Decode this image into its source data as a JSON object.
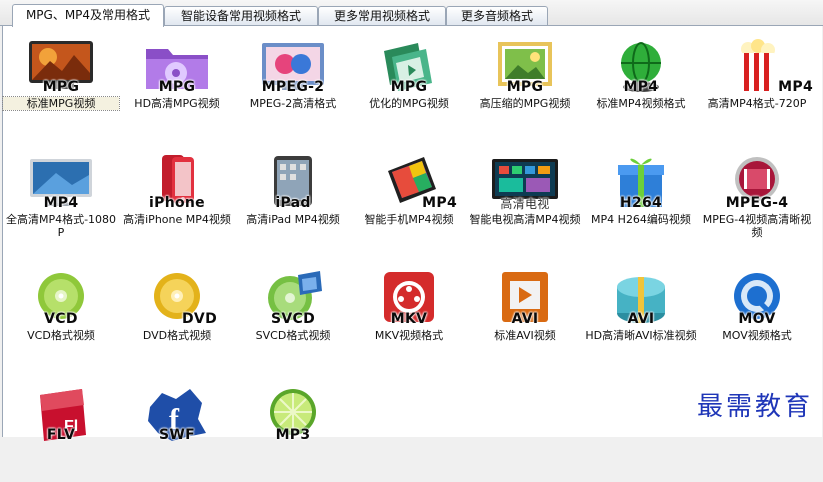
{
  "tabs": [
    {
      "label": "MPG、MP4及常用格式",
      "active": true
    },
    {
      "label": "智能设备常用视频格式",
      "active": false
    },
    {
      "label": "更多常用视频格式",
      "active": false
    },
    {
      "label": "更多音频格式",
      "active": false
    }
  ],
  "formats": [
    {
      "label": "MPG",
      "caption": "标准MPG视频",
      "icon": "film-projector-icon"
    },
    {
      "label": "MPG",
      "caption": "HD高清MPG视频",
      "icon": "media-folder-icon"
    },
    {
      "label": "MPEG-2",
      "caption": "MPEG-2高清格式",
      "icon": "mpeg2-screen-icon"
    },
    {
      "label": "MPG",
      "caption": "优化的MPG视频",
      "icon": "film-reel-icon"
    },
    {
      "label": "MPG",
      "caption": "高压缩的MPG视频",
      "icon": "photo-frame-icon"
    },
    {
      "label": "MP4",
      "caption": "标准MP4视频格式",
      "icon": "green-globe-icon"
    },
    {
      "label": "MP4",
      "caption": "高清MP4格式-720P",
      "icon": "popcorn-icon"
    },
    {
      "label": "MP4",
      "caption": "全高清MP4格式-1080P",
      "icon": "monitor-icon"
    },
    {
      "label": "iPhone",
      "caption": "高清iPhone MP4视频",
      "icon": "iphone-icon"
    },
    {
      "label": "iPad",
      "caption": "高清iPad MP4视频",
      "icon": "ipad-icon"
    },
    {
      "label": "MP4",
      "caption": "智能手机MP4视频",
      "icon": "smartphone-icon"
    },
    {
      "label": "高清电视",
      "caption": "智能电视高清MP4视频",
      "icon": "smart-tv-icon"
    },
    {
      "label": "H264",
      "caption": "MP4 H264编码视频",
      "icon": "gift-box-icon"
    },
    {
      "label": "MPEG-4",
      "caption": "MPEG-4视频高清晰视频",
      "icon": "film-badge-icon"
    },
    {
      "label": "VCD",
      "caption": "VCD格式视频",
      "icon": "vcd-disc-icon"
    },
    {
      "label": "DVD",
      "caption": "DVD格式视频",
      "icon": "dvd-disc-icon"
    },
    {
      "label": "SVCD",
      "caption": "SVCD格式视频",
      "icon": "svcd-disc-icon"
    },
    {
      "label": "MKV",
      "caption": "MKV视频格式",
      "icon": "mkv-reel-icon"
    },
    {
      "label": "AVI",
      "caption": "标准AVI视频",
      "icon": "avi-play-icon"
    },
    {
      "label": "AVI",
      "caption": "HD高清晰AVI标准视频",
      "icon": "teal-gift-icon"
    },
    {
      "label": "MOV",
      "caption": "MOV视频格式",
      "icon": "quicktime-icon"
    },
    {
      "label": "FLV",
      "caption": "",
      "icon": "flash-file-icon"
    },
    {
      "label": "SWF",
      "caption": "",
      "icon": "facebook-splash-icon"
    },
    {
      "label": "MP3",
      "caption": "",
      "icon": "lime-slice-icon"
    }
  ],
  "watermark": "最需教育"
}
